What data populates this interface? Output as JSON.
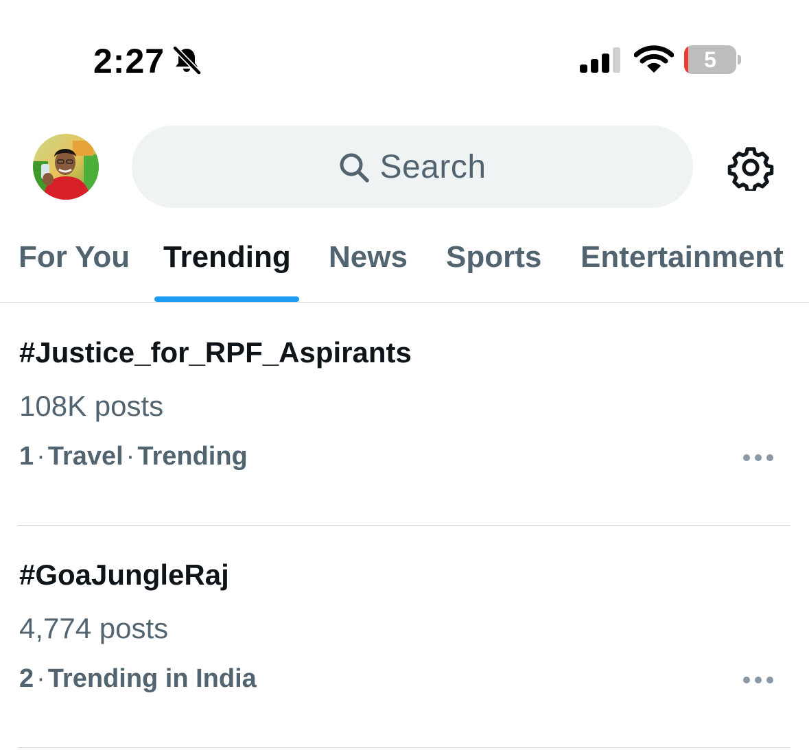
{
  "status_bar": {
    "time": "2:27",
    "battery_level": "5",
    "battery_fraction": 0.05,
    "icons": [
      "bell-slash-icon",
      "cellular-signal-icon",
      "wifi-icon",
      "battery-icon"
    ]
  },
  "header": {
    "avatar": "profile-avatar",
    "search_placeholder": "Search",
    "settings_icon": "gear-icon"
  },
  "tabs": [
    {
      "label": "For You",
      "active": false
    },
    {
      "label": "Trending",
      "active": true
    },
    {
      "label": "News",
      "active": false
    },
    {
      "label": "Sports",
      "active": false
    },
    {
      "label": "Entertainment",
      "active": false
    }
  ],
  "trends": [
    {
      "title": "#Justice_for_RPF_Aspirants",
      "posts": "108K posts",
      "rank": "1",
      "meta_1": "Travel",
      "meta_2": "Trending"
    },
    {
      "title": "#GoaJungleRaj",
      "posts": "4,774 posts",
      "rank": "2",
      "meta_1": "Trending in India"
    }
  ],
  "colors": {
    "accent": "#1d9bf0",
    "text_primary": "#0f1419",
    "text_secondary": "#536471",
    "search_bg": "#eff3f4",
    "divider": "#cfd9de",
    "battery_low": "#ec3c32"
  }
}
